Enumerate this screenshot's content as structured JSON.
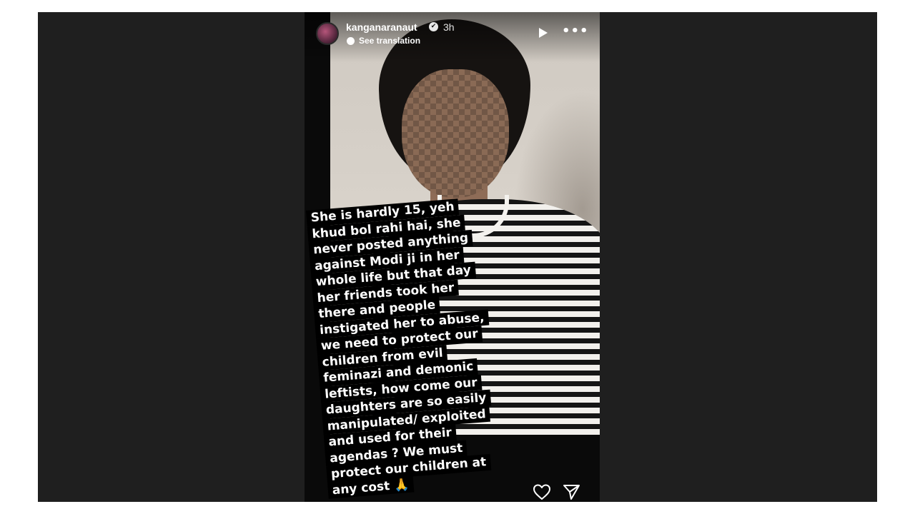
{
  "story": {
    "username": "kanganaranaut",
    "verified_glyph": "✔",
    "timestamp": "3h",
    "see_translation": "See translation",
    "more_glyph": "•••",
    "caption_lines": [
      "She is hardly 15, yeh",
      "khud bol rahi hai, she",
      "never posted anything",
      "against Modi ji in her",
      "whole life but that day",
      "her friends took her",
      "there and people",
      "instigated her to abuse,",
      "we need to protect our",
      "children from evil",
      "feminazi and demonic",
      "leftists, how come our",
      "daughters are so easily",
      "manipulated/ exploited",
      "and used for their",
      "agendas ? We must",
      "protect our children at",
      "any cost 🙏"
    ]
  },
  "navigation": {
    "prev_glyph": "‹"
  },
  "icons": {
    "avatar": "avatar-image",
    "verified": "verified-badge-icon",
    "translate": "translate-icon",
    "play": "play-icon",
    "more": "more-options-icon",
    "heart": "heart-icon",
    "share": "send-share-icon",
    "prev": "chevron-left-icon"
  },
  "colors": {
    "viewer_background": "#1f1f1f",
    "caption_background": "#000000",
    "caption_text": "#ffffff"
  }
}
